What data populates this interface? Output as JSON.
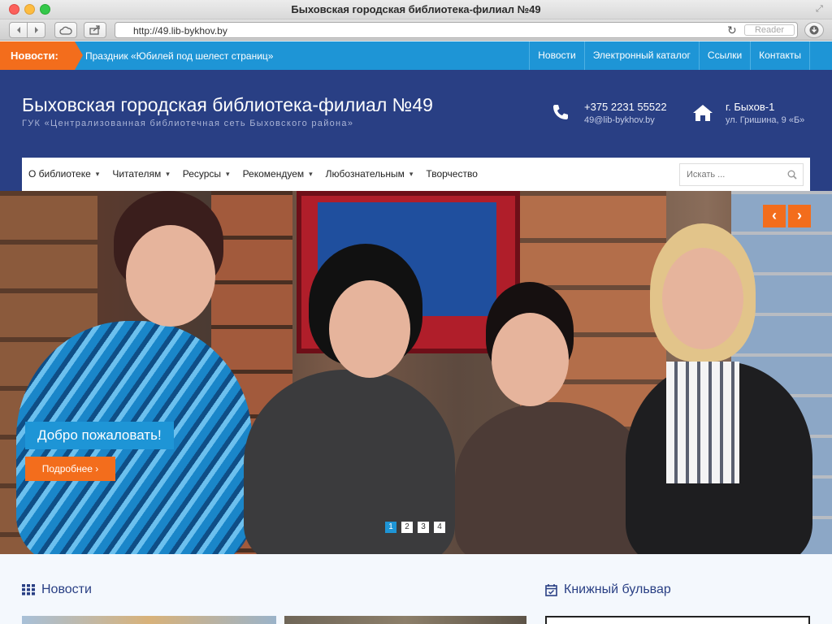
{
  "browser": {
    "window_title": "Быховская городская библиотека-филиал №49",
    "url": "http://49.lib-bykhov.by",
    "reader_label": "Reader"
  },
  "ticker": {
    "label": "Новости:",
    "text": "Праздник «Юбилей под шелест страниц»"
  },
  "top_links": [
    "Новости",
    "Электронный каталог",
    "Ссылки",
    "Контакты"
  ],
  "header": {
    "title": "Быховская городская библиотека-филиал №49",
    "subtitle": "ГУК «Централизованная библиотечная сеть Быховского района»",
    "phone": "+375 2231 55522",
    "email": "49@lib-bykhov.by",
    "city": "г. Быхов-1",
    "street": "ул. Гришина, 9 «Б»"
  },
  "menu": {
    "items": [
      {
        "label": "О библиотеке",
        "has_dropdown": true
      },
      {
        "label": "Читателям",
        "has_dropdown": true
      },
      {
        "label": "Ресурсы",
        "has_dropdown": true
      },
      {
        "label": "Рекомендуем",
        "has_dropdown": true
      },
      {
        "label": "Любознательным",
        "has_dropdown": true
      },
      {
        "label": "Творчество",
        "has_dropdown": false
      }
    ],
    "search_placeholder": "Искать ..."
  },
  "slider": {
    "caption": "Добро пожаловать!",
    "button_label": "Подробнее ›",
    "prev_icon": "‹",
    "next_icon": "›",
    "pages": [
      "1",
      "2",
      "3",
      "4"
    ],
    "active_page": "1"
  },
  "sections": {
    "news_title": "Новости",
    "books_title": "Книжный бульвар"
  },
  "colors": {
    "accent_orange": "#f36d1c",
    "accent_blue": "#1e95d6",
    "header_navy": "#293f84"
  }
}
